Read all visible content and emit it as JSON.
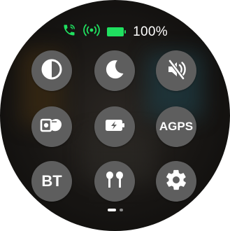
{
  "status": {
    "battery_percent": "100%",
    "battery_level": 1.0,
    "icons": [
      "phone-connected-icon",
      "wireless-signal-icon",
      "battery-full-icon"
    ],
    "accent_color": "#20e060"
  },
  "controls": [
    {
      "id": "brightness",
      "icon": "contrast-icon"
    },
    {
      "id": "do-not-disturb",
      "icon": "moon-icon"
    },
    {
      "id": "mute",
      "icon": "speaker-muted-icon"
    },
    {
      "id": "wrist-raise",
      "icon": "wrist-raise-icon"
    },
    {
      "id": "power-saving",
      "icon": "battery-charging-icon"
    },
    {
      "id": "agps",
      "label": "AGPS"
    },
    {
      "id": "bluetooth",
      "label": "BT"
    },
    {
      "id": "earbuds",
      "icon": "earbuds-icon"
    },
    {
      "id": "settings",
      "icon": "gear-icon"
    }
  ],
  "pagination": {
    "current_page": 1,
    "total_pages": 2
  }
}
